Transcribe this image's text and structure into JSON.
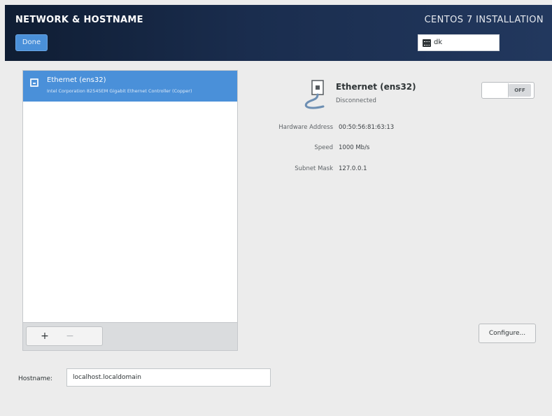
{
  "header": {
    "title": "NETWORK & HOSTNAME",
    "done_label": "Done",
    "install_title": "CENTOS 7 INSTALLATION",
    "keyboard_layout": "dk"
  },
  "devices": [
    {
      "name": "Ethernet (ens32)",
      "description": "Intel Corporation 82545EM Gigabit Ethernet Controller (Copper)",
      "selected": true
    }
  ],
  "list_toolbar": {
    "add_label": "+",
    "remove_label": "−"
  },
  "detail": {
    "name": "Ethernet (ens32)",
    "status": "Disconnected",
    "toggle_label": "OFF",
    "rows": [
      {
        "label": "Hardware Address",
        "value": "00:50:56:81:63:13"
      },
      {
        "label": "Speed",
        "value": "1000 Mb/s"
      },
      {
        "label": "Subnet Mask",
        "value": "127.0.0.1"
      }
    ],
    "configure_label": "Configure..."
  },
  "hostname": {
    "label": "Hostname:",
    "value": "localhost.localdomain"
  },
  "colors": {
    "header_bg": "#1a2d4e",
    "accent": "#4a90d9",
    "window_bg": "#ececec"
  }
}
